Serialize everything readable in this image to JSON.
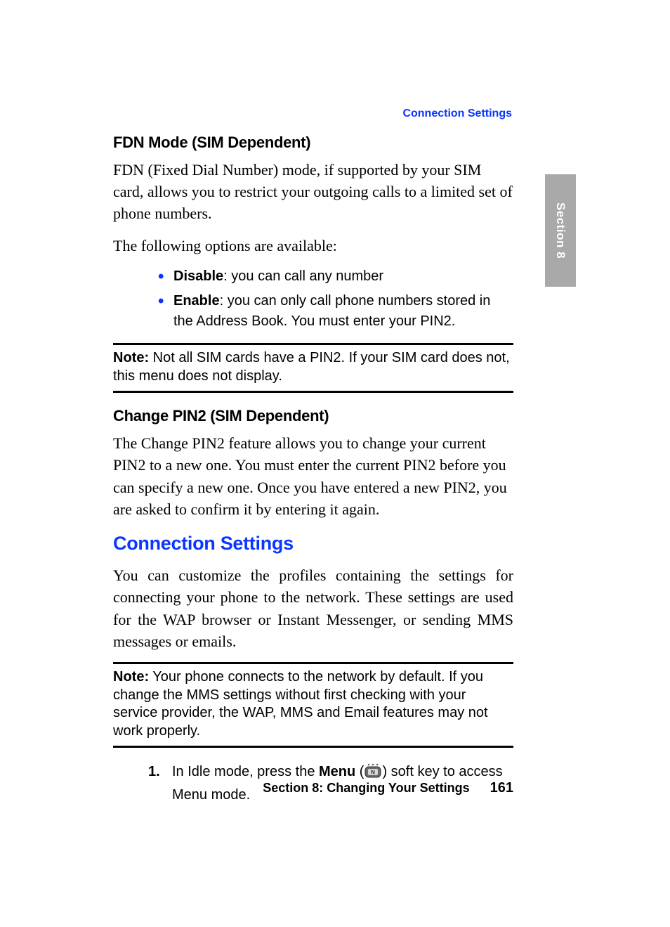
{
  "header": {
    "running_head": "Connection Settings"
  },
  "sidetab": {
    "label": "Section 8"
  },
  "fdn": {
    "heading": "FDN Mode (SIM Dependent)",
    "p1": "FDN (Fixed Dial Number) mode, if supported by your SIM card, allows you to restrict your outgoing calls to a limited set of phone numbers.",
    "p2": "The following options are available:",
    "opts": {
      "disable_label": "Disable",
      "disable_text": ": you can call any number",
      "enable_label": "Enable",
      "enable_text": ": you can only call phone numbers stored in the Address Book. You must enter your PIN2."
    }
  },
  "note1": {
    "label": "Note:",
    "text": " Not all SIM cards have a PIN2. If your SIM card does not, this menu does not display."
  },
  "pin2": {
    "heading": "Change PIN2 (SIM Dependent)",
    "p1": "The Change PIN2 feature allows you to change your current PIN2 to a new one. You must enter the current PIN2 before you can specify a new one. Once you have entered a new PIN2, you are asked to confirm it by entering it again."
  },
  "conn": {
    "heading": "Connection Settings",
    "p1": "You can customize the profiles containing the settings for connecting your phone to the network. These settings are used for the WAP browser or Instant Messenger, or sending MMS messages or emails."
  },
  "note2": {
    "label": "Note:",
    "text": " Your phone connects to the network by default. If you change the MMS settings without first checking with your service provider, the WAP, MMS and Email features may not work properly."
  },
  "steps": {
    "s1_a": "In Idle mode, press the ",
    "s1_menu": "Menu",
    "s1_b": " (",
    "s1_c": ") soft key to access Menu mode."
  },
  "footer": {
    "section": "Section 8: Changing Your Settings",
    "page": "161"
  }
}
